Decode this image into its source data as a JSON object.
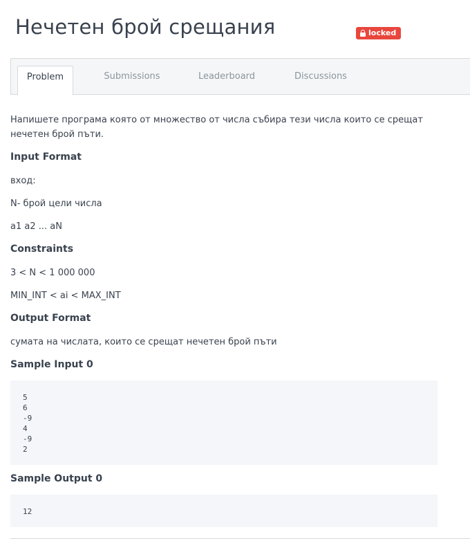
{
  "challenge": {
    "title": "Нечетен брой срещания",
    "badge": "locked"
  },
  "tabs": [
    {
      "label": "Problem",
      "active": true
    },
    {
      "label": "Submissions",
      "active": false
    },
    {
      "label": "Leaderboard",
      "active": false
    },
    {
      "label": "Discussions",
      "active": false
    }
  ],
  "problem": {
    "statement": "Напишете програма която от множество от числа събира тези числа които се срещат нечетен брой пъти.",
    "input_format_heading": "Input Format",
    "input_lines": [
      "вход:",
      "N- брой цели числа",
      "a1 a2 ... aN"
    ],
    "constraints_heading": "Constraints",
    "constraint_lines": [
      "3 < N < 1 000 000",
      "MIN_INT < ai < MAX_INT"
    ],
    "output_format_heading": "Output Format",
    "output_text": "сумата на числата, които се срещат нечетен брой пъти",
    "sample_input_heading": "Sample Input 0",
    "sample_input": "5\n6\n-9\n4\n-9\n2",
    "sample_output_heading": "Sample Output 0",
    "sample_output": "12"
  }
}
